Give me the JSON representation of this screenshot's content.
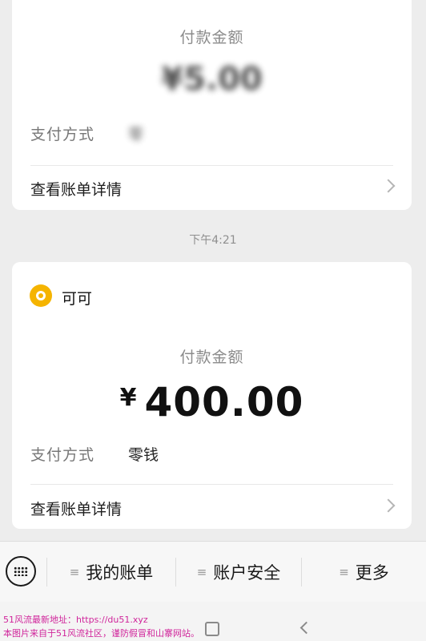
{
  "top_card": {
    "amount_title": "付款金额",
    "amount": "¥5.00",
    "payment_method_label": "支付方式",
    "payment_method_value": "零",
    "detail_link": "查看账单详情"
  },
  "timestamp": "下午4:21",
  "bottom_card": {
    "merchant_name": "可可",
    "amount_title": "付款金额",
    "amount_currency": "¥",
    "amount_value": "400.00",
    "payment_method_label": "支付方式",
    "payment_method_value": "零钱",
    "detail_link": "查看账单详情"
  },
  "bottom_menu": {
    "items": [
      {
        "icon": "menu-lines-icon",
        "glyph": "≡",
        "label": "我的账单"
      },
      {
        "icon": "menu-lines-icon",
        "glyph": "≡",
        "label": "账户安全"
      },
      {
        "icon": "menu-lines-icon",
        "glyph": "≡",
        "label": "更多"
      }
    ]
  },
  "watermark": {
    "line1": "51风流最新地址：https://du51.xyz",
    "line2": "本图片来自于51风流社区，谨防假冒和山寨网站。"
  },
  "colors": {
    "accent_yellow": "#f5b400",
    "watermark": "#d0259b",
    "background": "#ededed"
  }
}
